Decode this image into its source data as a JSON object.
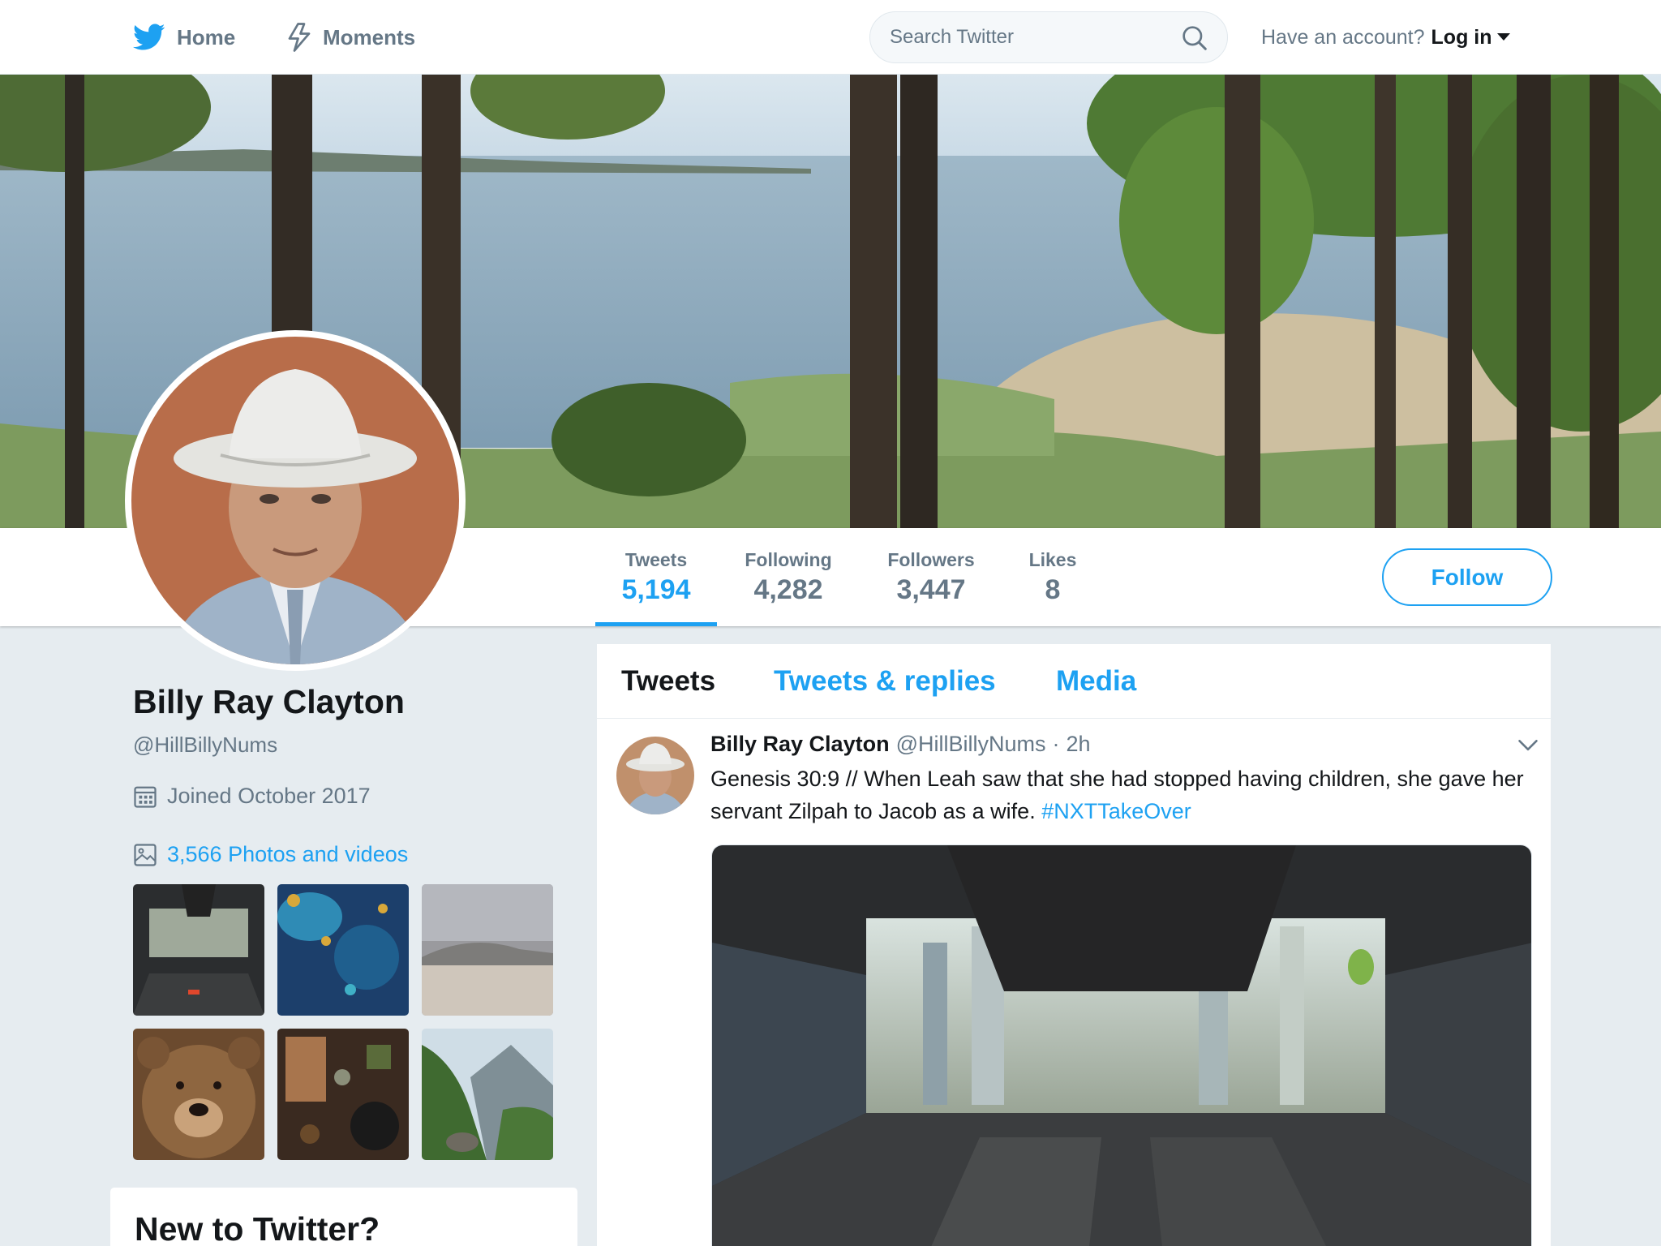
{
  "nav": {
    "home_label": "Home",
    "moments_label": "Moments",
    "search_placeholder": "Search Twitter",
    "have_account_text": "Have an account?",
    "login_label": "Log in"
  },
  "profile": {
    "full_name": "Billy Ray Clayton",
    "screen_name": "@HillBillyNums",
    "joined": "Joined October 2017",
    "photos_videos": "3,566 Photos and videos"
  },
  "stats": [
    {
      "label": "Tweets",
      "value": "5,194"
    },
    {
      "label": "Following",
      "value": "4,282"
    },
    {
      "label": "Followers",
      "value": "3,447"
    },
    {
      "label": "Likes",
      "value": "8"
    }
  ],
  "follow_label": "Follow",
  "timeline_tabs": [
    {
      "label": "Tweets"
    },
    {
      "label": "Tweets & replies"
    },
    {
      "label": "Media"
    }
  ],
  "tweet": {
    "name": "Billy Ray Clayton",
    "handle": "@HillBillyNums",
    "separator": "·",
    "time": "2h",
    "text": "Genesis 30:9 // When Leah saw that she had stopped having children, she gave her servant Zilpah to Jacob as a wife. ",
    "hashtag": "#NXTTakeOver"
  },
  "signup": {
    "title": "New to Twitter?"
  },
  "colors": {
    "accent": "#1da1f2",
    "background": "#e6ecf0",
    "secondary_text": "#657786",
    "primary_text": "#14171a"
  }
}
